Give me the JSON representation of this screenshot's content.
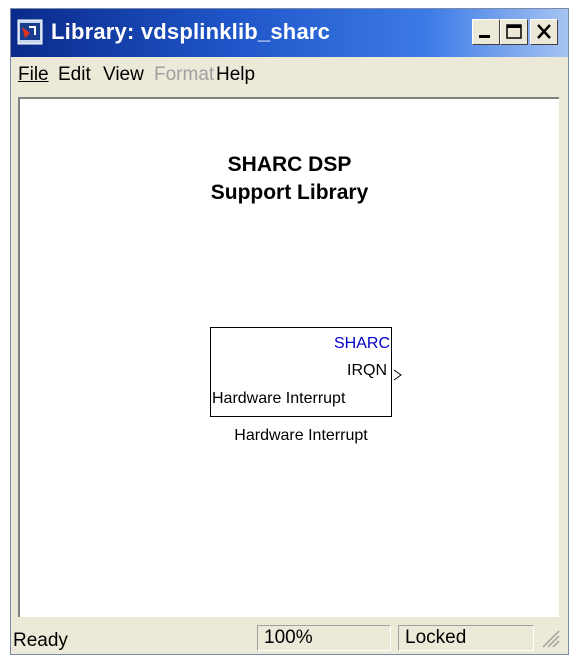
{
  "window": {
    "title": "Library: vdsplinklib_sharc"
  },
  "menu": [
    {
      "label": "File",
      "enabled": true
    },
    {
      "label": "Edit",
      "enabled": true
    },
    {
      "label": "View",
      "enabled": true
    },
    {
      "label": "Format",
      "enabled": false
    },
    {
      "label": "Help",
      "enabled": true
    }
  ],
  "canvas": {
    "title_line1": "SHARC DSP",
    "title_line2": "Support Library",
    "block": {
      "vendor_label": "SHARC",
      "port_label": "IRQN",
      "inner_label": "Hardware Interrupt",
      "caption": "Hardware Interrupt"
    }
  },
  "status": {
    "state": "Ready",
    "zoom": "100%",
    "lock": "Locked"
  },
  "icons": [
    "simulink-app-icon",
    "minimize-icon",
    "maximize-icon",
    "close-icon",
    "output-port-arrow-icon",
    "resize-grip-icon"
  ],
  "colors": {
    "titlebar_start": "#0a2a8a",
    "titlebar_end": "#a6c4f2",
    "sharc_label": "#0000cc",
    "chrome": "#ece9d8"
  }
}
